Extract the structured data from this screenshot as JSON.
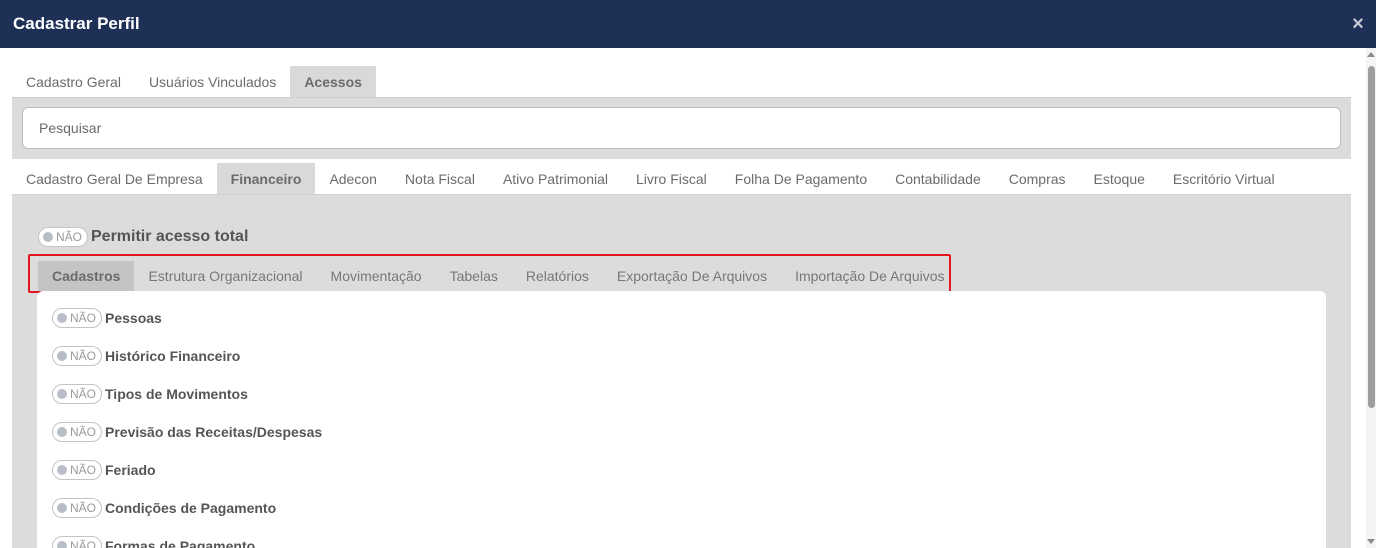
{
  "window": {
    "title": "Cadastrar Perfil",
    "close_glyph": "×"
  },
  "top_tabs": [
    {
      "label": "Cadastro Geral",
      "active": false
    },
    {
      "label": "Usuários Vinculados",
      "active": false
    },
    {
      "label": "Acessos",
      "active": true
    }
  ],
  "search": {
    "placeholder": "Pesquisar",
    "value": ""
  },
  "module_tabs": [
    {
      "label": "Cadastro Geral De Empresa",
      "active": false
    },
    {
      "label": "Financeiro",
      "active": true
    },
    {
      "label": "Adecon",
      "active": false
    },
    {
      "label": "Nota Fiscal",
      "active": false
    },
    {
      "label": "Ativo Patrimonial",
      "active": false
    },
    {
      "label": "Livro Fiscal",
      "active": false
    },
    {
      "label": "Folha De Pagamento",
      "active": false
    },
    {
      "label": "Contabilidade",
      "active": false
    },
    {
      "label": "Compras",
      "active": false
    },
    {
      "label": "Estoque",
      "active": false
    },
    {
      "label": "Escritório Virtual",
      "active": false
    }
  ],
  "total_access": {
    "toggle_label": "NÃO",
    "label": "Permitir acesso total"
  },
  "sub_tabs": [
    {
      "label": "Cadastros",
      "active": true
    },
    {
      "label": "Estrutura Organizacional",
      "active": false
    },
    {
      "label": "Movimentação",
      "active": false
    },
    {
      "label": "Tabelas",
      "active": false
    },
    {
      "label": "Relatórios",
      "active": false
    },
    {
      "label": "Exportação De Arquivos",
      "active": false
    },
    {
      "label": "Importação De Arquivos",
      "active": false
    }
  ],
  "permissions": [
    {
      "toggle_label": "NÃO",
      "label": "Pessoas"
    },
    {
      "toggle_label": "NÃO",
      "label": "Histórico Financeiro"
    },
    {
      "toggle_label": "NÃO",
      "label": "Tipos de Movimentos"
    },
    {
      "toggle_label": "NÃO",
      "label": "Previsão das Receitas/Despesas"
    },
    {
      "toggle_label": "NÃO",
      "label": "Feriado"
    },
    {
      "toggle_label": "NÃO",
      "label": "Condições de Pagamento"
    },
    {
      "toggle_label": "NÃO",
      "label": "Formas de Pagamento"
    }
  ],
  "colors": {
    "header": "#1f3057",
    "panel": "#dcdcdc",
    "highlight": "#e0161e"
  }
}
